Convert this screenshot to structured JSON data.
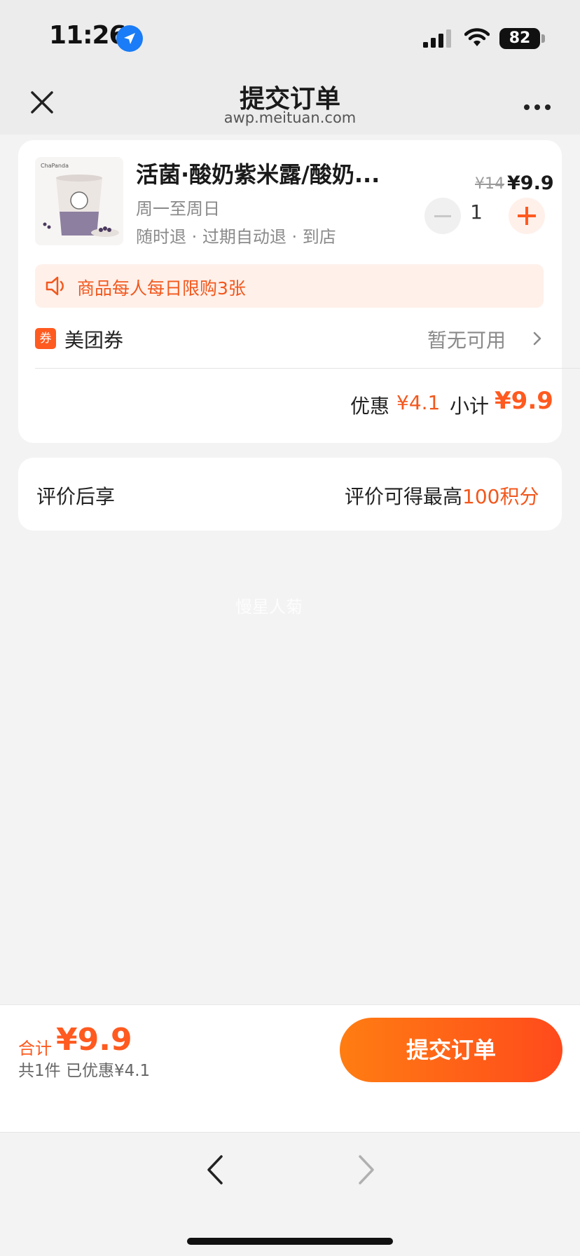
{
  "status_bar": {
    "time": "11:26",
    "battery": "82"
  },
  "nav": {
    "title": "提交订单",
    "url": "awp.meituan.com"
  },
  "product": {
    "thumb_brand": "ChaPanda",
    "name": "活菌·酸奶紫米露/酸奶...",
    "days": "周一至周日",
    "policy": "随时退 · 过期自动退 · 到店",
    "price_original": "¥14",
    "price_current": "¥9.9",
    "quantity": "1"
  },
  "limit_notice": "商品每人每日限购3张",
  "coupon": {
    "badge": "券",
    "label": "美团券",
    "status": "暂无可用"
  },
  "summary": {
    "discount_label": "优惠",
    "discount_value": "¥4.1",
    "subtotal_label": "小计",
    "subtotal_value": "¥9.9"
  },
  "review": {
    "label": "评价后享",
    "text_prefix": "评价可得最高",
    "points": "100积分"
  },
  "watermark": "慢星人菊",
  "bottom": {
    "total_label": "合计",
    "total_value": "¥9.9",
    "detail": "共1件  已优惠¥4.1",
    "submit_label": "提交订单"
  },
  "colors": {
    "accent": "#ff5a1f",
    "accent_text": "#f2581d",
    "banner_bg": "#fff0ea",
    "page_bg": "#f3f3f3"
  },
  "icons": [
    "location-arrow-icon",
    "signal-icon",
    "wifi-icon",
    "close-icon",
    "more-icon",
    "speaker-icon",
    "chevron-right-icon",
    "back-arrow-icon",
    "forward-arrow-icon"
  ]
}
